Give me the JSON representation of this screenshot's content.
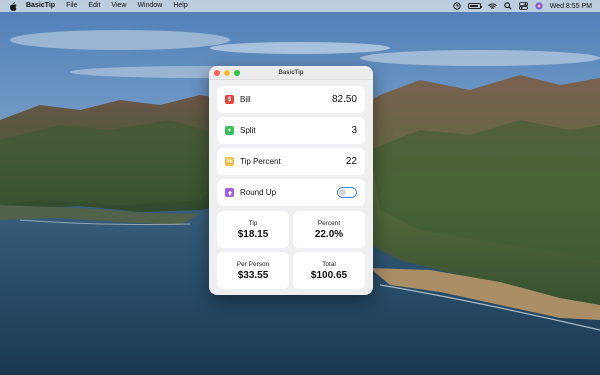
{
  "menubar": {
    "app_name": "BasicTip",
    "menus": [
      "File",
      "Edit",
      "View",
      "Window",
      "Help"
    ],
    "clock": "Wed 8:55 PM",
    "battery_level": 0.85
  },
  "window": {
    "title": "BasicTip"
  },
  "inputs": [
    {
      "label": "Bill",
      "value": "82.50",
      "icon": "dollar-icon",
      "color": "#e8453c"
    },
    {
      "label": "Split",
      "value": "3",
      "icon": "plus-icon",
      "color": "#3bbf5e"
    },
    {
      "label": "Tip Percent",
      "value": "22",
      "icon": "percent-icon",
      "color": "#f5c04a"
    }
  ],
  "round_up": {
    "label": "Round Up",
    "icon": "arrow-up-icon",
    "color": "#a45be0",
    "enabled": false
  },
  "results": [
    {
      "label": "Tip",
      "value": "$18.15"
    },
    {
      "label": "Percent",
      "value": "22.0%"
    },
    {
      "label": "Per Person",
      "value": "$33.55"
    },
    {
      "label": "Total",
      "value": "$100.65"
    }
  ]
}
